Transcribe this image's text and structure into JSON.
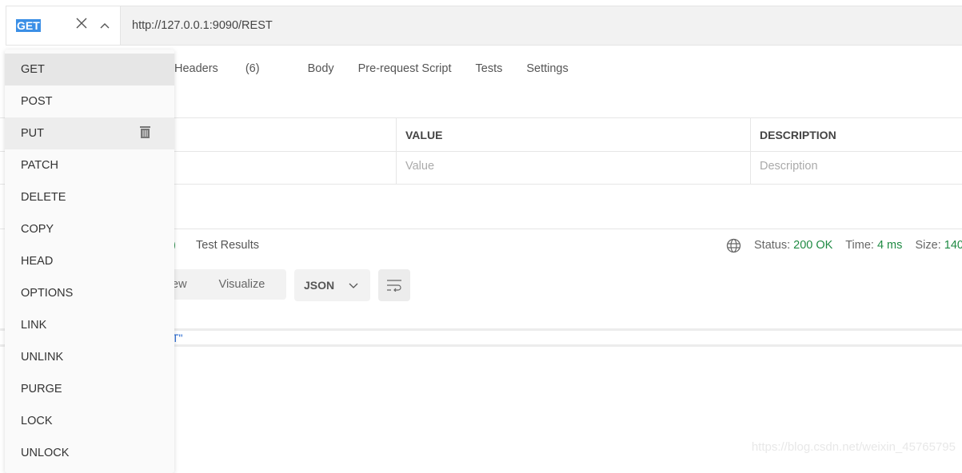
{
  "request": {
    "method": "GET",
    "url": "http://127.0.0.1:9090/REST"
  },
  "tabs": [
    {
      "label": "Headers",
      "count": "(6)"
    },
    {
      "label": "Body"
    },
    {
      "label": "Pre-request Script"
    },
    {
      "label": "Tests"
    },
    {
      "label": "Settings"
    }
  ],
  "table": {
    "headers": [
      "VALUE",
      "DESCRIPTION"
    ],
    "placeholders": [
      "Value",
      "Description"
    ]
  },
  "response": {
    "tab_partial": ")",
    "tab_test_results": "Test Results",
    "status_label": "Status:",
    "status": "200 OK",
    "time_label": "Time:",
    "time": "4 ms",
    "size_label": "Size:",
    "size": "140",
    "view_partial": "ew",
    "visualize": "Visualize",
    "format": "JSON",
    "body_partial": "T\""
  },
  "menu": {
    "items": [
      "GET",
      "POST",
      "PUT",
      "PATCH",
      "DELETE",
      "COPY",
      "HEAD",
      "OPTIONS",
      "LINK",
      "UNLINK",
      "PURGE",
      "LOCK",
      "UNLOCK"
    ]
  },
  "watermark": "https://blog.csdn.net/weixin_45765795",
  "colors": {
    "accent_green": "#1f8a43",
    "selection": "#3b8fe6"
  }
}
